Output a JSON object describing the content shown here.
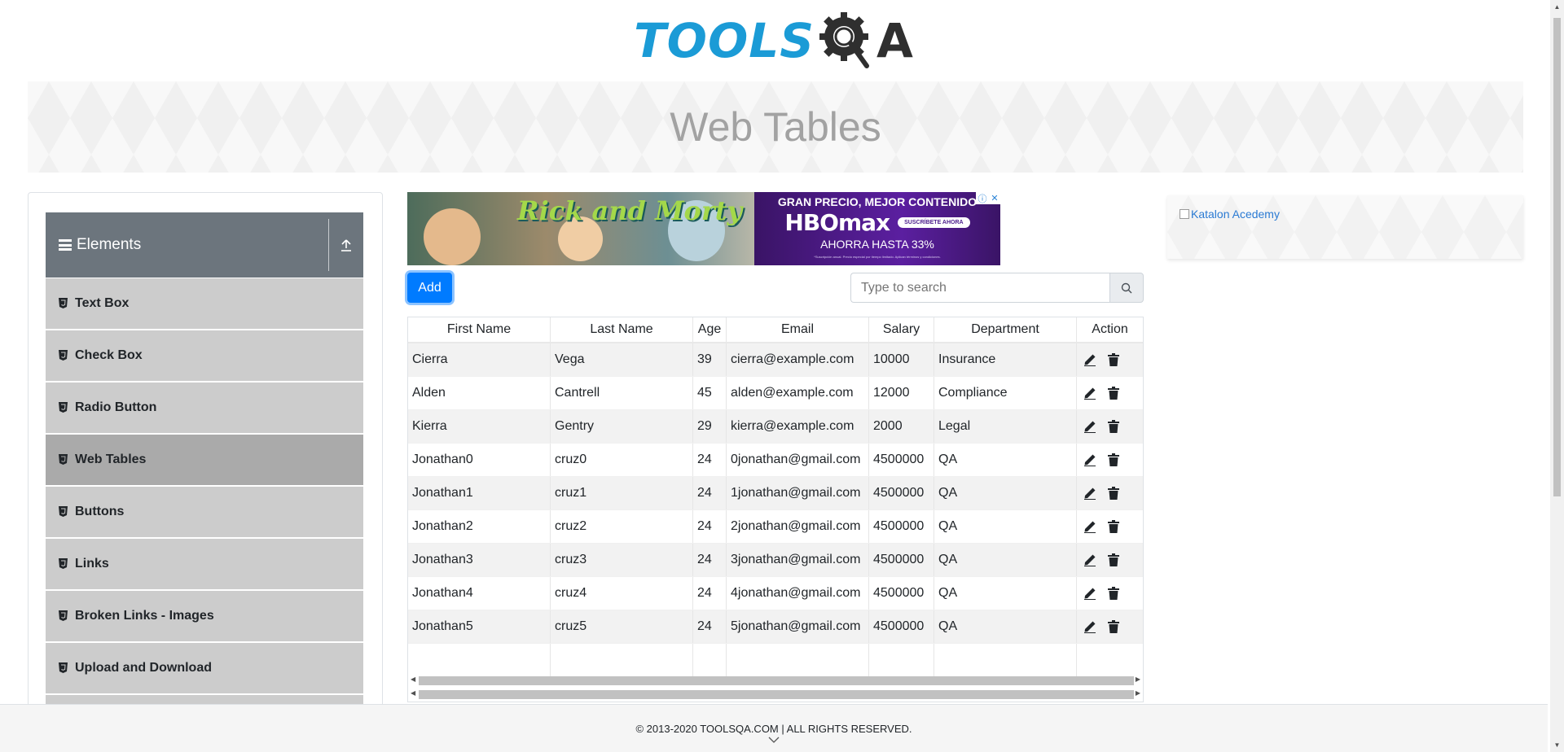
{
  "header": {
    "logo_left": "TOOLS",
    "logo_right": "A",
    "logo_gear_text": "Q"
  },
  "banner": {
    "title": "Web Tables"
  },
  "sidebar": {
    "group": {
      "label": "Elements",
      "icon": "hamburger-icon",
      "collapse_icon": "upload-icon"
    },
    "items": [
      {
        "label": "Text Box",
        "active": false
      },
      {
        "label": "Check Box",
        "active": false
      },
      {
        "label": "Radio Button",
        "active": false
      },
      {
        "label": "Web Tables",
        "active": true
      },
      {
        "label": "Buttons",
        "active": false
      },
      {
        "label": "Links",
        "active": false
      },
      {
        "label": "Broken Links - Images",
        "active": false
      },
      {
        "label": "Upload and Download",
        "active": false
      }
    ]
  },
  "ad": {
    "left_text": "Rick and Morty",
    "right_line1": "GRAN PRECIO, MEJOR CONTENIDO",
    "right_brand": "HBOmax",
    "right_cta": "SUSCRÍBETE AHORA",
    "right_line3": "AHORRA HASTA 33%",
    "right_fine": "*Suscripción anual. Precio especial por tiempo limitado. Aplican términos y condiciones."
  },
  "toolbar": {
    "add_label": "Add",
    "search_placeholder": "Type to search",
    "search_icon": "search-icon"
  },
  "table": {
    "columns": [
      "First Name",
      "Last Name",
      "Age",
      "Email",
      "Salary",
      "Department",
      "Action"
    ],
    "rows": [
      [
        "Cierra",
        "Vega",
        "39",
        "cierra@example.com",
        "10000",
        "Insurance"
      ],
      [
        "Alden",
        "Cantrell",
        "45",
        "alden@example.com",
        "12000",
        "Compliance"
      ],
      [
        "Kierra",
        "Gentry",
        "29",
        "kierra@example.com",
        "2000",
        "Legal"
      ],
      [
        "Jonathan0",
        "cruz0",
        "24",
        "0jonathan@gmail.com",
        "4500000",
        "QA"
      ],
      [
        "Jonathan1",
        "cruz1",
        "24",
        "1jonathan@gmail.com",
        "4500000",
        "QA"
      ],
      [
        "Jonathan2",
        "cruz2",
        "24",
        "2jonathan@gmail.com",
        "4500000",
        "QA"
      ],
      [
        "Jonathan3",
        "cruz3",
        "24",
        "3jonathan@gmail.com",
        "4500000",
        "QA"
      ],
      [
        "Jonathan4",
        "cruz4",
        "24",
        "4jonathan@gmail.com",
        "4500000",
        "QA"
      ],
      [
        "Jonathan5",
        "cruz5",
        "24",
        "5jonathan@gmail.com",
        "4500000",
        "QA"
      ]
    ],
    "action_icons": [
      "pencil-icon",
      "trash-icon"
    ]
  },
  "right_ad": {
    "alt_text": "Katalon Acedemy"
  },
  "footer": {
    "copyright": "© 2013-2020 TOOLSQA.COM | ALL RIGHTS RESERVED."
  },
  "colors": {
    "brand_blue": "#1b9bd6",
    "primary": "#007bff",
    "sidebar_header": "#6c757d",
    "menu_item": "#cccccc",
    "menu_item_active": "#aaaaaa"
  }
}
